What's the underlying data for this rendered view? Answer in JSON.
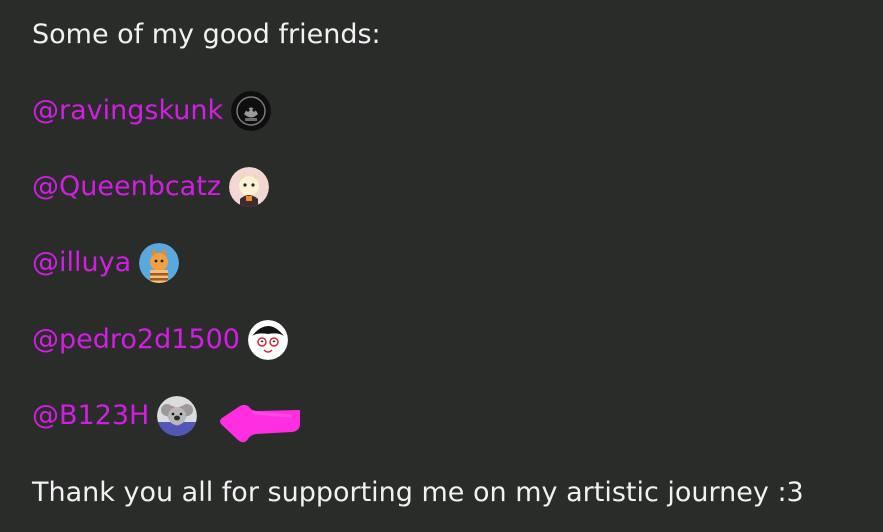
{
  "heading": "Some of my good friends:",
  "friends": [
    {
      "handle": "@ravingskunk",
      "avatar_icon": "skunk-emblem-avatar"
    },
    {
      "handle": "@Queenbcatz",
      "avatar_icon": "cat-character-avatar"
    },
    {
      "handle": "@illuya",
      "avatar_icon": "fox-character-avatar"
    },
    {
      "handle": "@pedro2d1500",
      "avatar_icon": "penguin-face-avatar"
    },
    {
      "handle": "@B123H",
      "avatar_icon": "koala-heart-avatar"
    }
  ],
  "footer": "Thank you all for supporting me on my artistic journey :3",
  "colors": {
    "background": "#2a2c2a",
    "text": "#f1f1f1",
    "mention": "#d21ee3",
    "arrow": "#ff2ee0"
  },
  "annotation_icon": "hand-drawn-arrow-icon"
}
